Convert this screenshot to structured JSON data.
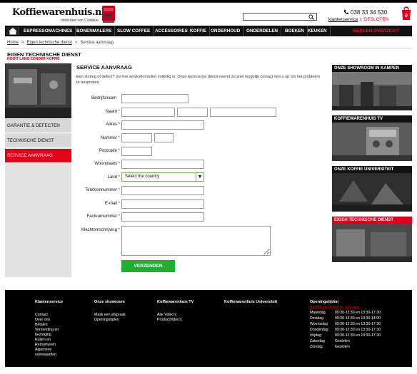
{
  "header": {
    "logo_text": "Koffiewarenhuis.nl",
    "logo_sub": "onderdeel van Coolblue",
    "phone": "038 33 34 530",
    "klantenservice": "klantenservice",
    "separator": "|",
    "status": "GESLOTEN",
    "search": {
      "placeholder": ""
    },
    "cart_count": "0"
  },
  "nav": {
    "items": [
      "ESPRESSOMACHINES",
      "BONENMALERS",
      "SLOW COFFEE",
      "ACCESSOIRES",
      "KOFFIE",
      "ONDERHOUD",
      "ONDERDELEN",
      "BOEKEN",
      "KEUKEN"
    ],
    "merken": "MERKEN OVERZICHT"
  },
  "breadcrumb": [
    "Home",
    "Eigen technische dienst",
    "Service aanvraag"
  ],
  "sidebar": {
    "title": "EIGEN TECHNISCHE DIENST",
    "subtitle": "NOOIT LANG ZONDER KOFFIE",
    "items": [
      "GARANTIE & DEFECTEN",
      "TECHNISCHE DIENST",
      "SERVICE AANVRAAG"
    ]
  },
  "form": {
    "title": "SERVICE AANVRAAG",
    "intro": "Een storing of defect? Vul het serviceformulier volledig in. Onze technische dienst neemt zo snel mogelijk contact met u op om het probleem te bespreken.",
    "labels": {
      "bedrijfsnaam": "Bedrijfsnaam",
      "naam": "Naam",
      "adres": "Adres",
      "nummer": "Nummer",
      "postcode": "Postcode",
      "woonplaats": "Woonplaats",
      "land": "Land",
      "telefoon": "Telefoonnummer",
      "email": "E-mail",
      "factuur": "Factuurnummer",
      "klacht": "Klachtomschrijving"
    },
    "required_mark": "*",
    "country_selected": "Select the country",
    "submit": "VERZENDEN"
  },
  "panels": [
    {
      "title": "ONZE SHOWROOM IN KAMPEN"
    },
    {
      "title": "KOFFIEWARENHUIS TV"
    },
    {
      "title": "ONZE KOFFIE UNIVERSITEIT"
    },
    {
      "title": "EIGEN TECHNISCHE DIENST"
    }
  ],
  "footer": {
    "klantenservice": {
      "title": "Klantenservice",
      "links": [
        "Contact",
        "Over ons",
        "Betalen",
        "Verzending en",
        "bezorging",
        "Ruilen en",
        "Retourneren",
        "Algemene",
        "voorwaarden"
      ]
    },
    "showroom": {
      "title": "Onze showroom",
      "links": [
        "Mask een afspraak",
        "Openingstijden"
      ]
    },
    "tv": {
      "title": "Koffiewarenhuis TV",
      "links": [
        "Alle Video's",
        "ProductVideo's"
      ]
    },
    "universiteit": {
      "title": "Koffiewarenhuis Universiteit"
    },
    "openingstijden": {
      "title": "Openingstijden",
      "note": "Bezoek showroom op afspraak",
      "rows": [
        {
          "day": "Maandag",
          "time": "09:30-12:30 en 13:30-17:30"
        },
        {
          "day": "Dinsdag",
          "time": "09:30-12:30 en 13:30-14:00"
        },
        {
          "day": "Woensdag",
          "time": "09:30-12:30 en 13:30-17:30"
        },
        {
          "day": "Donderdag",
          "time": "09:30-12:30 en 13:30-17:30"
        },
        {
          "day": "Vrijdag",
          "time": "09:30-12:30 en 13:30-17:30"
        },
        {
          "day": "Zaterdag",
          "time": "Gesloten"
        },
        {
          "day": "Zondag",
          "time": "Gesloten"
        }
      ]
    }
  },
  "colors": {
    "brand_red": "#e3001b",
    "nav_bg": "#111111",
    "submit_green": "#20b030"
  }
}
